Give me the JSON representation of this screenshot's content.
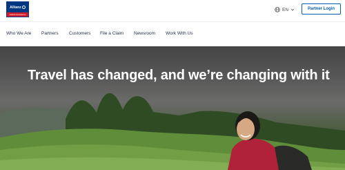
{
  "brand": {
    "name": "Allianz",
    "sub": "Global Assistance"
  },
  "header": {
    "language": "EN",
    "partner_login": "Partner Login"
  },
  "nav": {
    "items": [
      "Who We Are",
      "Partners",
      "Customers",
      "File a Claim",
      "Newsroom",
      "Work With Us"
    ]
  },
  "hero": {
    "title": "Travel has changed, and we’re changing with it"
  },
  "colors": {
    "brand_blue": "#003781",
    "accent_blue": "#005eb8",
    "brand_red": "#d11b2a"
  },
  "icons": {
    "language": "globe-icon",
    "language_toggle": "chevron-down-icon"
  }
}
